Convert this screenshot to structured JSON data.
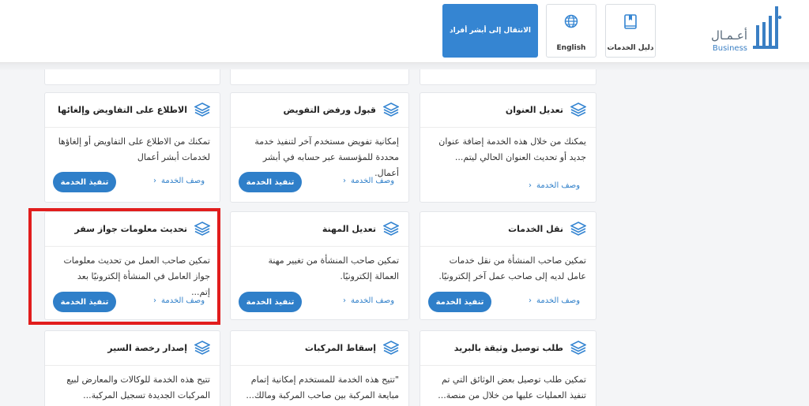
{
  "header": {
    "logo": {
      "arabic": "أعـمـال",
      "english": "Business"
    },
    "guide_button": {
      "label": "دليل الخدمات",
      "icon": "book-icon"
    },
    "english_button": {
      "label": "English",
      "icon": "globe-icon"
    },
    "absher_button": {
      "label": "الانتقال إلى أبشر أفراد"
    }
  },
  "colors": {
    "primary": "#2f7fc9",
    "highlight": "#e11d1d",
    "background": "#f4f5f7"
  },
  "cards": [
    {
      "title": "تعديل العنوان",
      "desc": "يمكنك من خلال هذه الخدمة إضافة عنوان جديد أو تحديث العنوان الحالي ليتم...",
      "link": "وصف الخدمة",
      "exec": ""
    },
    {
      "title": "قبول ورفض التفويض",
      "desc": "إمكانية تفويض مستخدم آخر لتنفيذ خدمة محددة للمؤسسة عبر حسابه في أبشر أعمال.",
      "link": "وصف الخدمة",
      "exec": "تنفيذ الخدمة"
    },
    {
      "title": "الاطلاع على التفاويض وإلغائها",
      "desc": "تمكنك من الاطلاع على التفاويض أو إلغاؤها لخدمات أبشر أعمال",
      "link": "وصف الخدمة",
      "exec": "تنفيذ الخدمة"
    },
    {
      "title": "نقل الخدمات",
      "desc": "تمكين صاحب المنشأة من نقل خدمات عامل لديه إلى صاحب عمل آخر إلكترونيًا.",
      "link": "وصف الخدمة",
      "exec": "تنفيذ الخدمة"
    },
    {
      "title": "تعديل المهنة",
      "desc": "تمكين صاحب المنشأة من تغيير مهنة العمالة إلكترونيًا.",
      "link": "وصف الخدمة",
      "exec": "تنفيذ الخدمة"
    },
    {
      "title": "تحديث معلومات جواز سفر",
      "desc": "تمكين صاحب العمل من تحديث معلومات جواز العامل في المنشأة إلكترونيًا بعد إتم...",
      "link": "وصف الخدمة",
      "exec": "تنفيذ الخدمة"
    },
    {
      "title": "طلب توصيل وثيقة بالبريد",
      "desc": "تمكين طلب توصيل بعض الوثائق التي تم تنفيذ العمليات عليها من خلال من منصة...",
      "link": "",
      "exec": ""
    },
    {
      "title": "إسقاط المركبات",
      "desc": "\"تتيح هذه الخدمة للمستخدم إمكانية إتمام مبايعة المركبة بين صاحب المركبة ومالك...",
      "link": "",
      "exec": ""
    },
    {
      "title": "إصدار رخصة السير",
      "desc": "تتيح هذه الخدمة للوكالات والمعارض لبيع المركبات الجديدة تسجيل المركبة...",
      "link": "",
      "exec": ""
    }
  ]
}
